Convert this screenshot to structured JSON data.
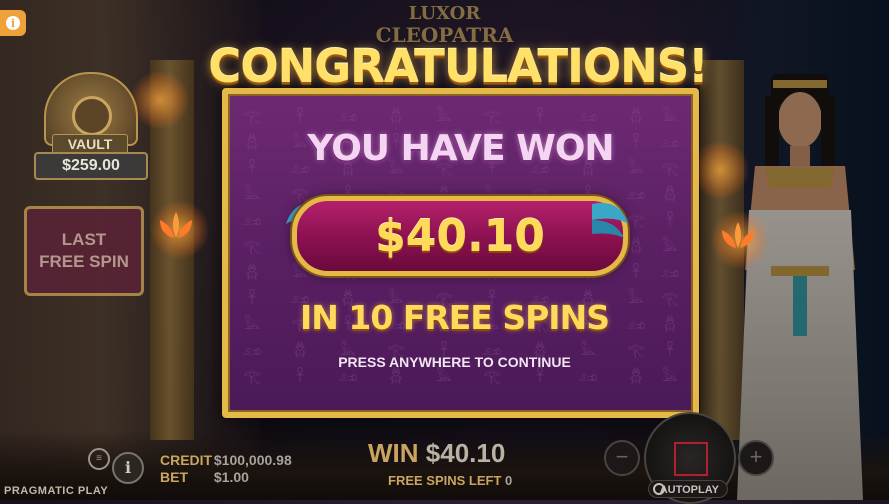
{
  "game": {
    "logo_line1": "LUXOR",
    "logo_line2": "CLEOPATRA",
    "brand": "PRAGMATIC PLAY"
  },
  "popup": {
    "heading": "CONGRATULATIONS!",
    "subheading": "YOU HAVE WON",
    "win_amount": "$40.10",
    "spins_text": "IN 10 FREE SPINS",
    "continue_text": "PRESS ANYWHERE TO CONTINUE"
  },
  "vault": {
    "label": "VAULT",
    "amount": "$259.00"
  },
  "last_free_spin": {
    "label": "LAST FREE SPIN"
  },
  "bottom_bar": {
    "credit_label": "CREDIT",
    "credit_value": "$100,000.98",
    "bet_label": "BET",
    "bet_value": "$1.00",
    "win_label": "WIN",
    "win_value": "$40.10",
    "free_spins_left_label": "FREE SPINS LEFT",
    "free_spins_left_value": "0",
    "autoplay_label": "AUTOPLAY",
    "plus_symbol": "+",
    "minus_symbol": "−"
  },
  "icons": {
    "info": "info-icon",
    "menu": "menu-icon",
    "spin": "spin-icon",
    "autoplay": "autoplay-icon"
  },
  "colors": {
    "gold": "#e5b84a",
    "panel_purple": "#5a1f63",
    "win_bar_magenta": "#8a1050",
    "info_orange": "#f0a23a"
  }
}
